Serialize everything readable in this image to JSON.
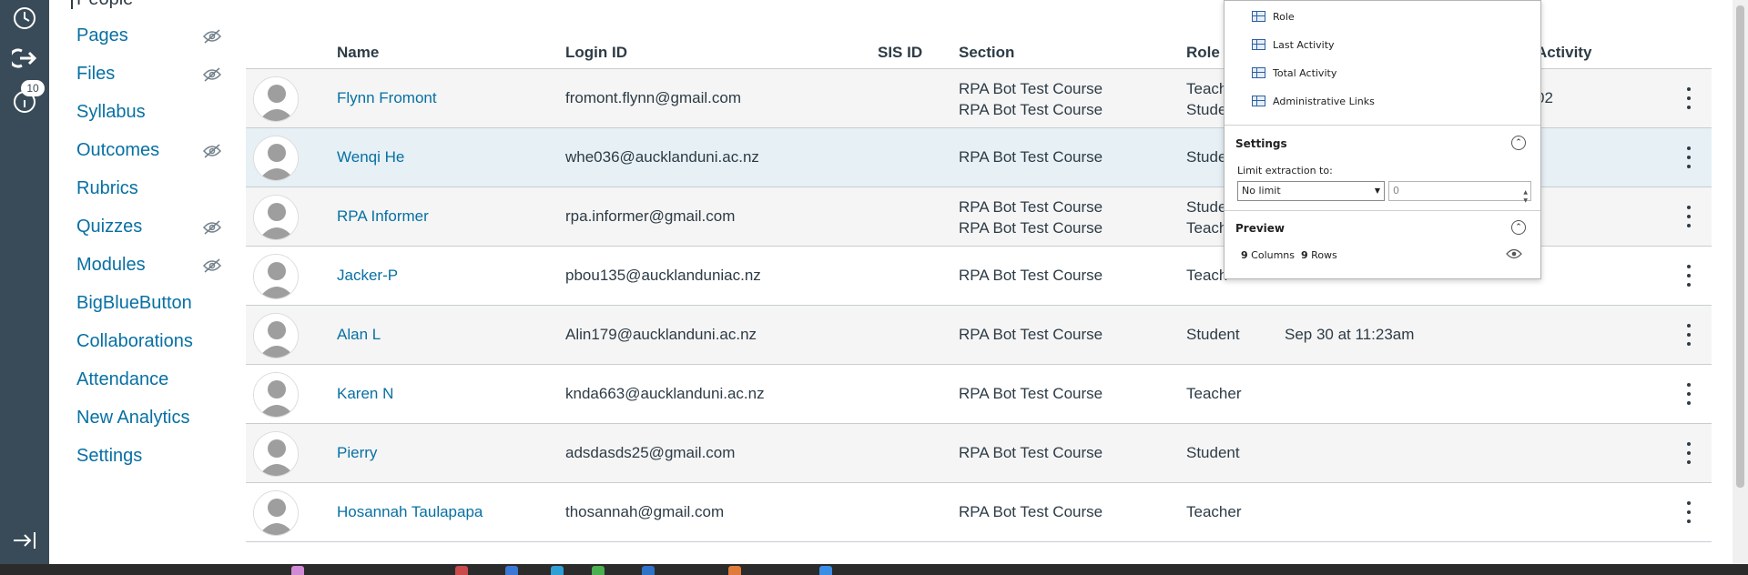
{
  "global_nav": {
    "notification_count": "10"
  },
  "course_nav": {
    "current_heading": "People",
    "items": [
      {
        "label": "Pages",
        "hidden": true
      },
      {
        "label": "Files",
        "hidden": true
      },
      {
        "label": "Syllabus",
        "hidden": false
      },
      {
        "label": "Outcomes",
        "hidden": true
      },
      {
        "label": "Rubrics",
        "hidden": false
      },
      {
        "label": "Quizzes",
        "hidden": true
      },
      {
        "label": "Modules",
        "hidden": true
      },
      {
        "label": "BigBlueButton",
        "hidden": false
      },
      {
        "label": "Collaborations",
        "hidden": false
      },
      {
        "label": "Attendance",
        "hidden": false
      },
      {
        "label": "New Analytics",
        "hidden": false
      },
      {
        "label": "Settings",
        "hidden": false
      }
    ]
  },
  "table": {
    "headers": {
      "name": "Name",
      "login": "Login ID",
      "sis": "SIS ID",
      "section": "Section",
      "role": "Role",
      "activity": "Activity"
    },
    "rows": [
      {
        "name": "Flynn Fromont",
        "login": "fromont.flynn@gmail.com",
        "section1": "RPA Bot Test Course",
        "section2": "RPA Bot Test Course",
        "role1": "Teach",
        "role2": "Stude",
        "last": "",
        "total": "02"
      },
      {
        "name": "Wenqi He",
        "login": "whe036@aucklanduni.ac.nz",
        "section1": "RPA Bot Test Course",
        "section2": "",
        "role1": "Stude",
        "role2": "",
        "last": "",
        "total": ""
      },
      {
        "name": "RPA Informer",
        "login": "rpa.informer@gmail.com",
        "section1": "RPA Bot Test Course",
        "section2": "RPA Bot Test Course",
        "role1": "Stude",
        "role2": "Teach",
        "last": "",
        "total": ""
      },
      {
        "name": "Jacker-P",
        "login": "pbou135@aucklanduniac.nz",
        "section1": "RPA Bot Test Course",
        "section2": "",
        "role1": "Teach",
        "role2": "",
        "last": "",
        "total": ""
      },
      {
        "name": "Alan L",
        "login": "Alin179@aucklanduni.ac.nz",
        "section1": "RPA Bot Test Course",
        "section2": "",
        "role1": "Student",
        "role2": "",
        "last": "Sep 30 at 11:23am",
        "total": ""
      },
      {
        "name": "Karen N",
        "login": "knda663@aucklanduni.ac.nz",
        "section1": "RPA Bot Test Course",
        "section2": "",
        "role1": "Teacher",
        "role2": "",
        "last": "",
        "total": ""
      },
      {
        "name": "Pierry",
        "login": "adsdasds25@gmail.com",
        "section1": "RPA Bot Test Course",
        "section2": "",
        "role1": "Student",
        "role2": "",
        "last": "",
        "total": ""
      },
      {
        "name": "Hosannah Taulapapa",
        "login": "thosannah@gmail.com",
        "section1": "RPA Bot Test Course",
        "section2": "",
        "role1": "Teacher",
        "role2": "",
        "last": "",
        "total": ""
      }
    ]
  },
  "popup": {
    "fields": [
      "Role",
      "Last Activity",
      "Total Activity",
      "Administrative Links"
    ],
    "settings_title": "Settings",
    "limit_label": "Limit extraction to:",
    "limit_select": "No limit",
    "limit_value": "0",
    "preview_title": "Preview",
    "preview_columns": "9",
    "preview_columns_label": "Columns",
    "preview_rows": "9",
    "preview_rows_label": "Rows"
  },
  "colors": {
    "global_nav": "#394b58",
    "link": "#0770a3",
    "row_highlight": "#e6f0f5"
  },
  "icons": [
    "clock-icon",
    "logout-icon",
    "help-icon",
    "collapse-nav-icon",
    "eye-off-icon",
    "avatar-icon",
    "kebab-icon",
    "grid-field-icon",
    "eye-icon"
  ]
}
